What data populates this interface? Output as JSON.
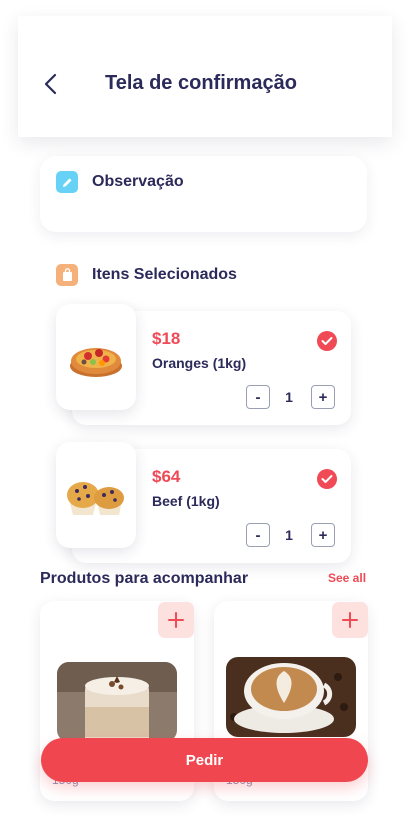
{
  "header": {
    "title": "Tela de confirmação",
    "back_icon": "chevron-left-icon"
  },
  "observation": {
    "label": "Observação",
    "icon": "pencil-icon",
    "icon_color": "#67d2f5"
  },
  "selected": {
    "label": "Itens Selecionados",
    "icon": "bag-icon",
    "icon_color": "#f6b07a",
    "items": [
      {
        "price": "$18",
        "name": "Oranges (1kg)",
        "quantity": "1",
        "image": "fruit-tart-image",
        "checked": true
      },
      {
        "price": "$64",
        "name": "Beef (1kg)",
        "quantity": "1",
        "image": "muffins-image",
        "checked": true
      }
    ],
    "minus_label": "-",
    "plus_label": "+"
  },
  "accompany": {
    "title": "Produtos para acompanhar",
    "see_all": "See all",
    "products": [
      {
        "image": "cappuccino-image",
        "weight": "150g",
        "add_icon": "plus-icon"
      },
      {
        "image": "latte-art-image",
        "weight": "150g",
        "add_icon": "plus-icon"
      }
    ]
  },
  "order_button": {
    "label": "Pedir"
  },
  "colors": {
    "accent": "#ef4a55",
    "text": "#2b2a5a"
  }
}
